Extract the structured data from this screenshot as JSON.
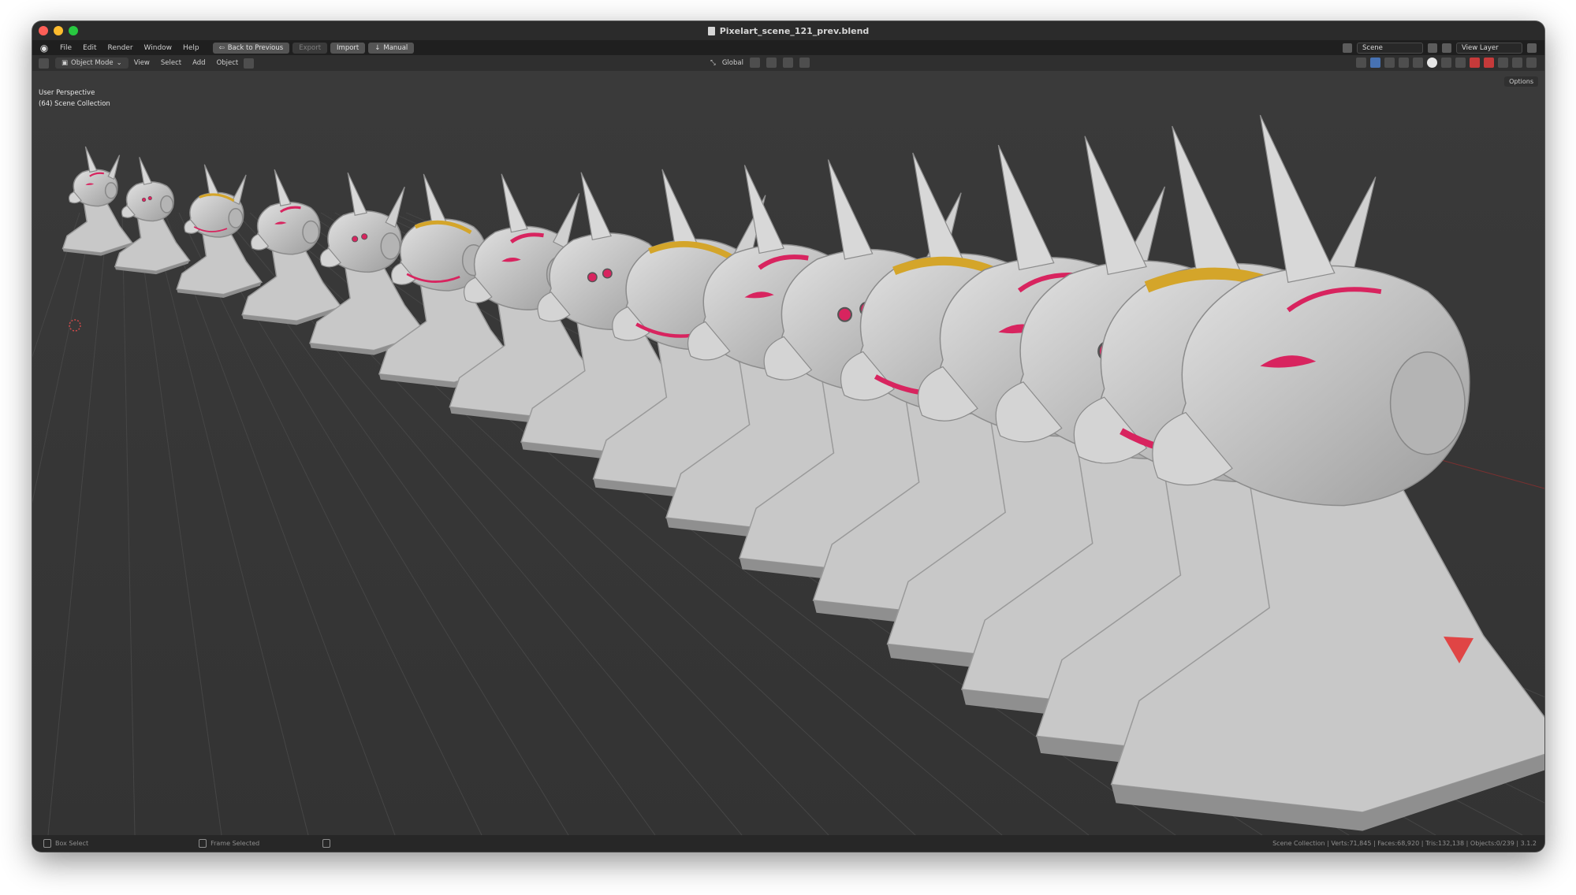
{
  "window": {
    "title": "Pixelart_scene_121_prev.blend"
  },
  "menubar": {
    "items": [
      "File",
      "Edit",
      "Render",
      "Window",
      "Help"
    ],
    "back_label": "Back to Previous",
    "export_label": "Export",
    "import_label": "Import",
    "manual_label": "Manual",
    "scene_value": "Scene",
    "view_layer_value": "View Layer"
  },
  "header": {
    "mode": "Object Mode",
    "items": [
      "View",
      "Select",
      "Add",
      "Object"
    ],
    "orientation": "Global"
  },
  "viewport": {
    "perspective_label": "User Perspective",
    "collection_label": "(64) Scene Collection",
    "options_label": "Options",
    "accent_color": "#d8245f",
    "gold_color": "#d4a52a",
    "mesh_color": "#c8c8c8"
  },
  "statusbar": {
    "box_select": "Box Select",
    "frame_selected": "Frame Selected",
    "stats": "Scene Collection | Verts:71,845 | Faces:68,920 | Tris:132,138 | Objects:0/239 | 3.1.2"
  }
}
